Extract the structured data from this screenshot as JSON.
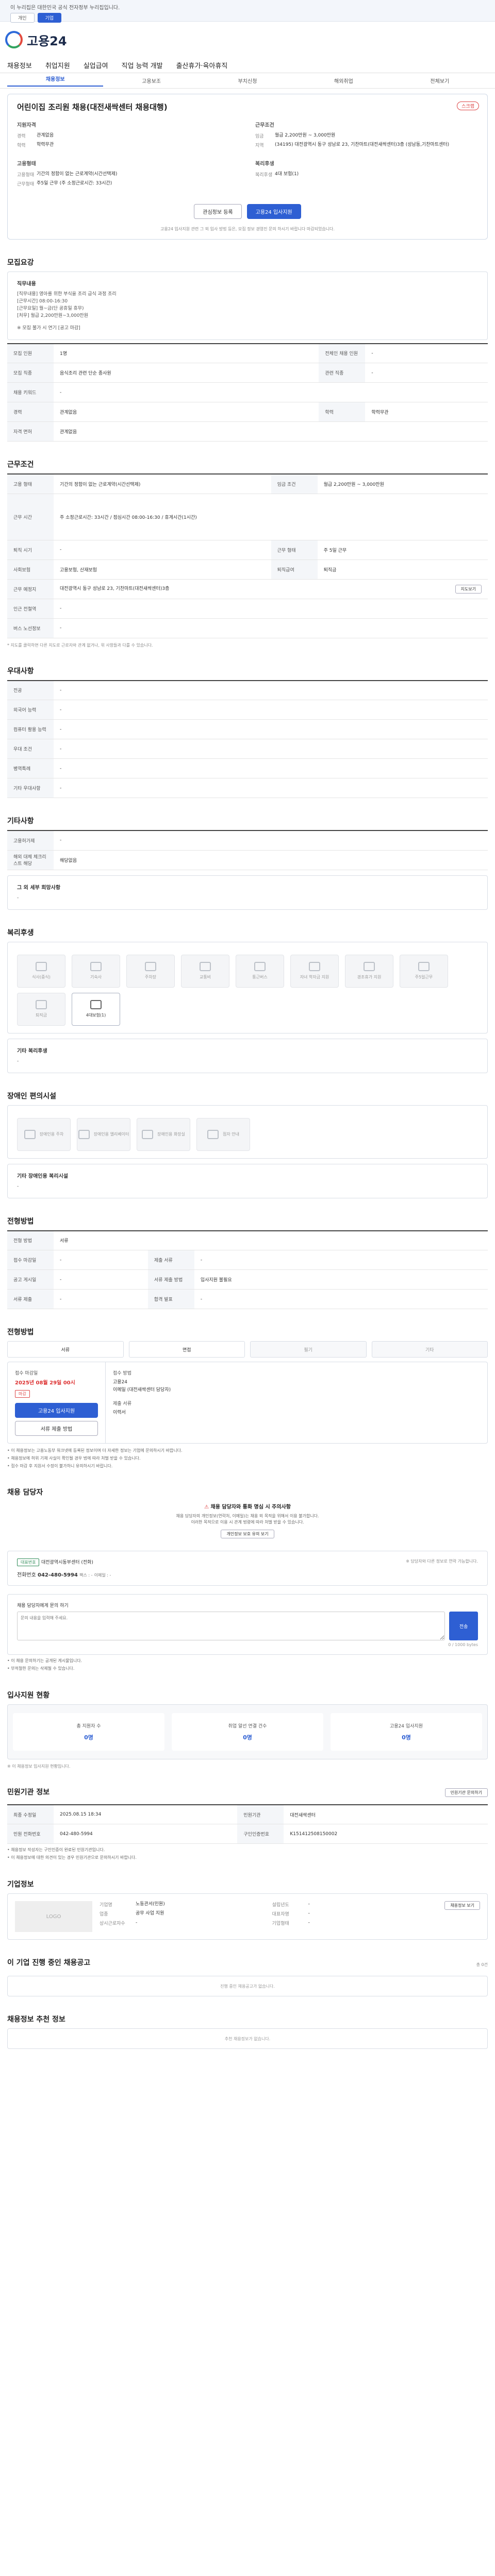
{
  "topbar": {
    "notice": "이 누리집은 대한민국 공식 전자정부 누리집입니다.",
    "btn1": "개인",
    "btn2": "기업"
  },
  "header": {
    "logo": "고용24"
  },
  "gnb": [
    "채용정보",
    "취업지원",
    "실업급여",
    "직업 능력 개발",
    "출산휴가·육아휴직"
  ],
  "subnav": [
    "채용정보",
    "고용보조",
    "부치신청",
    "해외취업",
    "전체보기"
  ],
  "hero": {
    "title": "어린이집 조리원 채용(대전새싹센터 채용대행)",
    "scrap": "스크랩",
    "left_heading": "지원자격",
    "right_heading": "근무조건",
    "qual": [
      {
        "k": "경력",
        "v": "관계없음"
      },
      {
        "k": "학력",
        "v": "학력무관"
      }
    ],
    "cond": [
      {
        "k": "임금",
        "v": "월급 2,200만원 ~ 3,000만원"
      },
      {
        "k": "지역",
        "v": "(34195) 대전광역시 동구 성남로 23, 기찬마트(대전새싹센터)3층 (성남동,기찬마트센터)"
      }
    ],
    "left_heading2": "고용형태",
    "right_heading2": "복리후생",
    "emp": [
      {
        "k": "고용형태",
        "v": "기간의 정함이 없는 근로계약(시간선택제)"
      },
      {
        "k": "근무형태",
        "v": "주5일 근무 (주 소정근로시간: 33시간)"
      }
    ],
    "welfare": [
      {
        "k": "복리후생",
        "v": "4대 보험(1)"
      }
    ],
    "btn_ask": "관심정보 등록",
    "btn_apply": "고용24 입사지원",
    "note": "고용24 입사지원 관련 그 외 입사 방법 등은, 모집 정보 경영진 문의 하시기 바랍니다 마감되었습니다."
  },
  "recruit": {
    "title": "모집요강",
    "duty_head": "직무내용",
    "duty_lines": [
      "[직무내용] 영아를 위한 부식을 조리 급식 과정 조리",
      "[근무시간] 08:00-16:30",
      "[근무요일] 월~금(단 공휴일 휴무)",
      "[처우] 월급 2,200만원~3,000만원",
      "※ 모집 불가 시 연기 [공고 마감]"
    ],
    "rows": [
      [
        "모집 인원",
        "1명",
        "전체인 채용 인원",
        "-"
      ],
      [
        "모집 직종",
        "음식조리 관련 단순 종사원",
        "관련 직종",
        "-"
      ],
      [
        "채용 키워드",
        "-",
        "",
        ""
      ],
      [
        "경력",
        "관계없음",
        "학력",
        "학력무관"
      ],
      [
        "자격 면허",
        "관계없음",
        "",
        ""
      ]
    ]
  },
  "work": {
    "title": "근무조건",
    "rows": [
      [
        "고용 형태",
        "기간의 정함이 없는 근로계약(시간선택제)",
        "임금 조건",
        "월급 2,200만원 ~ 3,000만원"
      ],
      [
        "근무 시간",
        "주 소정근로시간: 33시간 / 점심시간 08:00-16:30 / 휴게시간(1시간)",
        "",
        ""
      ],
      [
        "퇴직 시기",
        "-",
        "근무 형태",
        "주 5일 근무"
      ],
      [
        "사회보험",
        "고용보험, 산재보험",
        "퇴직급여",
        "퇴직금"
      ],
      [
        "근무 예정지",
        "대전광역시 동구 성남로 23, 기찬마트(대전새싹센터)3층",
        "지도보기",
        ""
      ],
      [
        "인근 전철역",
        "-",
        "",
        ""
      ],
      [
        "버스 노선정보",
        "-",
        "",
        ""
      ]
    ],
    "note": "* 지도를 클릭하면 다른 지도로 근로자와 관계 없거나, 위 사항들과 다를 수 있습니다."
  },
  "pref": {
    "title": "우대사항",
    "rows": [
      [
        "전공",
        "-"
      ],
      [
        "외국어 능력",
        "-"
      ],
      [
        "컴퓨터 활용 능력",
        "-"
      ],
      [
        "우대 조건",
        "-"
      ],
      [
        "병역특례",
        "-"
      ],
      [
        "기타 우대사항",
        "-"
      ]
    ]
  },
  "etc": {
    "title": "기타사항",
    "rows": [
      [
        "고용허가제",
        "-"
      ],
      [
        "해외 대체 체크리스트 해당",
        "해당없음"
      ]
    ],
    "extra_head": "그 외 세부 희망사항",
    "extra_val": "-"
  },
  "welfare": {
    "title": "복리후생",
    "items": [
      "식사(중식)",
      "기숙사",
      "주차장",
      "교통비",
      "통근버스",
      "자녀 학자금 지원",
      "경조휴가 지원",
      "주5일근무",
      "퇴직금",
      "4대보험(1)"
    ],
    "active": [
      "4대보험(1)"
    ],
    "other_head": "기타 복리후생",
    "other_val": "-"
  },
  "access": {
    "title": "장애인 편의시설",
    "items": [
      "장애인용 주차",
      "장애인용 엘리베이터",
      "장애인용 화장실",
      "점자 안내"
    ],
    "other_head": "기타 장애인용 복리시설",
    "other_val": "-"
  },
  "screening": {
    "title": "전형방법",
    "rows": [
      [
        "전형 방법",
        "서류"
      ],
      [
        "접수 마감일",
        "-"
      ],
      [
        "공고 게시일",
        "-"
      ],
      [
        "서류 제출",
        "-"
      ]
    ],
    "right_rows": [
      [
        "제출 서류",
        "-"
      ],
      [
        "서류 제출 방법",
        "입사지원 불필요"
      ],
      [
        "합격 발표",
        "-"
      ]
    ]
  },
  "apply": {
    "title": "전형방법",
    "steps": [
      "서류",
      "면접",
      "필기",
      "기타"
    ],
    "deadline_label": "접수 마감일",
    "deadline": "2025년 08월 29일 00시",
    "tag": "마감",
    "btn_apply": "고용24 입사지원",
    "btn_doc": "서류 제출 방법",
    "right_h1": "접수 방법",
    "right_v1": "고용24",
    "right_v2": "이메일 (대전새싹센터 담당자)",
    "right_h2": "제출 서류",
    "right_v3": "이력서",
    "bullets": [
      "• 이 채용정보는 고용노동부 워크넷에 등록된 정보이며 더 자세한 정보는 기업에 문의하시기 바랍니다.",
      "• 채용정보에 허위 기재 사실이 확인될 경우 법에 따라 처벌 받을 수 있습니다.",
      "• 접수 마감 후 지원서 수정이 불가하니 유의하시기 바랍니다."
    ]
  },
  "contact": {
    "title": "채용 담당자",
    "warn_title": "채용 담당자와 통화 명심 시 주의사항",
    "warn_lines": [
      "채용 담당자의 개인정보(연락처, 이메일)는 채용 외 목적을 위해서 이용 불가합니다.",
      "이러한 목적으로 이용 시 관계 법령에 따라 처벌 받을 수 있습니다."
    ],
    "btn_show": "개인정보 보호 유의 보기",
    "badge": "대표번호",
    "name": "대전광역시동부센터 (전화)",
    "phone_label": "전화번호",
    "phone": "042-480-5994",
    "fax": "팩스 : -",
    "email": "이메일 : -",
    "right": "※ 담당자와 다른 정보로 연락 가능합니다."
  },
  "qa": {
    "head": "채용 담당자에게 문의 하기",
    "placeholder": "문의 내용을 입력해 주세요.",
    "btn": "전송",
    "count": "0 / 1000 bytes",
    "notes": [
      "• 이 채용 문의하기는 공개된 게시물입니다.",
      "• 부적절한 문의는 삭제될 수 있습니다."
    ]
  },
  "stats": {
    "title": "입사지원 현황",
    "items": [
      [
        "총 지원자 수",
        "0명"
      ],
      [
        "취업 알선 연결 건수",
        "0명"
      ],
      [
        "고용24 입사지원",
        "0명"
      ]
    ],
    "note": "※ 이 채용정보 입사지원 현황입니다."
  },
  "reg": {
    "title": "민원기관 정보",
    "btn": "민원기관 문의하기",
    "rows": [
      [
        "최종 수정일",
        "2025.08.15 18:34",
        "민원기관",
        "대전새싹센터"
      ],
      [
        "민원 전화번호",
        "042-480-5994",
        "구인인증번호",
        "K151412508150002"
      ]
    ],
    "notes": [
      "• 채용정보 작성자는 구인인증이 완료된 민원기관입니다.",
      "• 이 채용정보에 대한 의견이 있는 경우 민원기관으로 문의하시기 바랍니다."
    ]
  },
  "company": {
    "title": "기업정보",
    "logo": "LOGO",
    "rows": [
      [
        "기업명",
        "노동관서(민원)"
      ],
      [
        "업종",
        "공무 사업 지원"
      ],
      [
        "상시근로자수",
        "-"
      ]
    ],
    "rows2": [
      [
        "설립년도",
        "-"
      ],
      [
        "대표자명",
        "-"
      ],
      [
        "기업형태",
        "-"
      ]
    ],
    "btn": "채용정보 보기"
  },
  "more": {
    "title": "이 기업 진행 중인 채용공고",
    "empty": "진행 중인 채용공고가 없습니다.",
    "right": "총 0건"
  },
  "recommend": {
    "title": "채용정보 추천 정보",
    "empty": "추천 채용정보가 없습니다."
  }
}
